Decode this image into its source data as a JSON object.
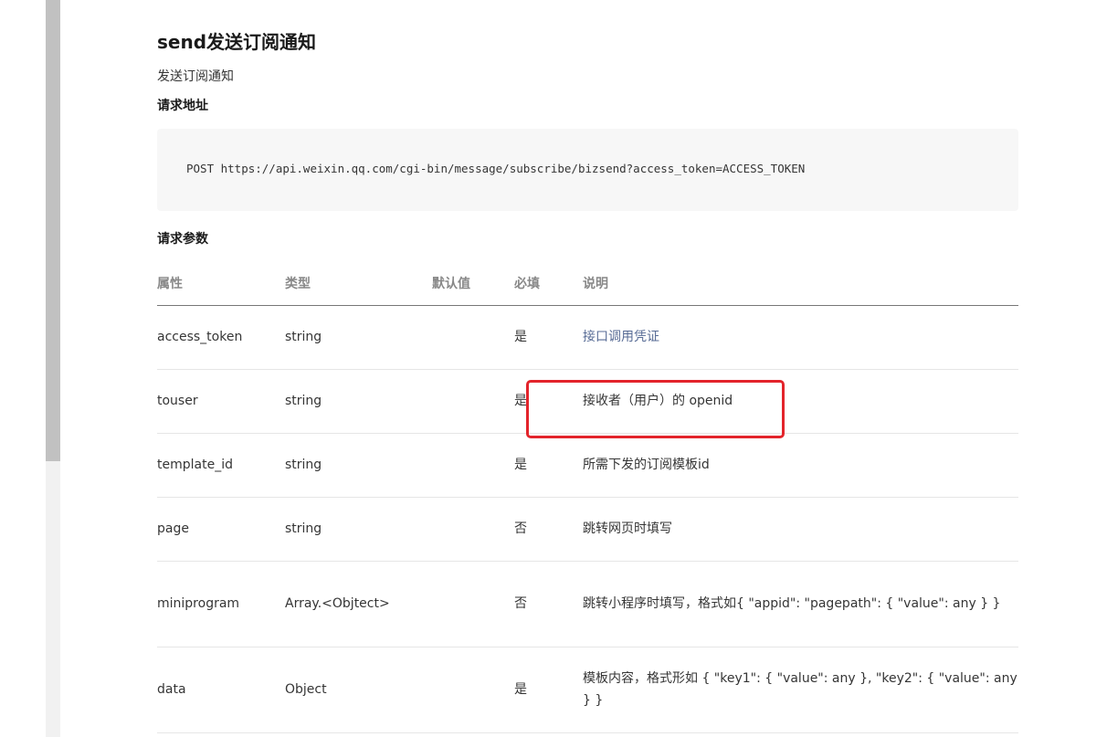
{
  "page": {
    "title": "send发送订阅通知",
    "description": "发送订阅通知",
    "request_url_heading": "请求地址",
    "request_url": "POST https://api.weixin.qq.com/cgi-bin/message/subscribe/bizsend?access_token=ACCESS_TOKEN",
    "params_heading": "请求参数"
  },
  "table": {
    "headers": [
      "属性",
      "类型",
      "默认值",
      "必填",
      "说明"
    ],
    "rows": [
      {
        "name": "access_token",
        "type": "string",
        "default": "",
        "required": "是",
        "desc": "接口调用凭证"
      },
      {
        "name": "touser",
        "type": "string",
        "default": "",
        "required": "是",
        "desc": "接收者（用户）的 openid"
      },
      {
        "name": "template_id",
        "type": "string",
        "default": "",
        "required": "是",
        "desc": "所需下发的订阅模板id"
      },
      {
        "name": "page",
        "type": "string",
        "default": "",
        "required": "否",
        "desc": "跳转网页时填写"
      },
      {
        "name": "miniprogram",
        "type": "Array.<Objtect>",
        "default": "",
        "required": "否",
        "desc": "跳转小程序时填写，格式如{ \"appid\": \"pagepath\": { \"value\": any } }"
      },
      {
        "name": "data",
        "type": "Object",
        "default": "",
        "required": "是",
        "desc": "模板内容，格式形如 { \"key1\": { \"value\": any }, \"key2\": { \"value\": any } }"
      }
    ]
  },
  "colors": {
    "link": "#576b95",
    "highlight": "#e3242b",
    "code_bg": "#f7f7f7"
  }
}
